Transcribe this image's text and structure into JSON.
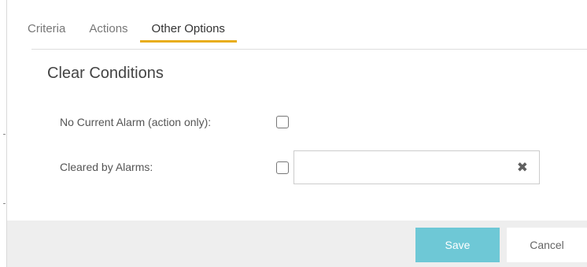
{
  "tabs": [
    {
      "label": "Criteria"
    },
    {
      "label": "Actions"
    },
    {
      "label": "Other Options",
      "active": true
    }
  ],
  "section": {
    "title": "Clear Conditions",
    "fields": [
      {
        "label": "No Current Alarm (action only):",
        "checked": false
      },
      {
        "label": "Cleared by Alarms:",
        "checked": false,
        "value": ""
      }
    ]
  },
  "footer": {
    "save_label": "Save",
    "cancel_label": "Cancel"
  },
  "icons": {
    "clear": "close-icon"
  },
  "colors": {
    "tab_accent": "#e8ad1b",
    "save_button": "#6ec8d6",
    "footer_background": "#eeeeee"
  }
}
